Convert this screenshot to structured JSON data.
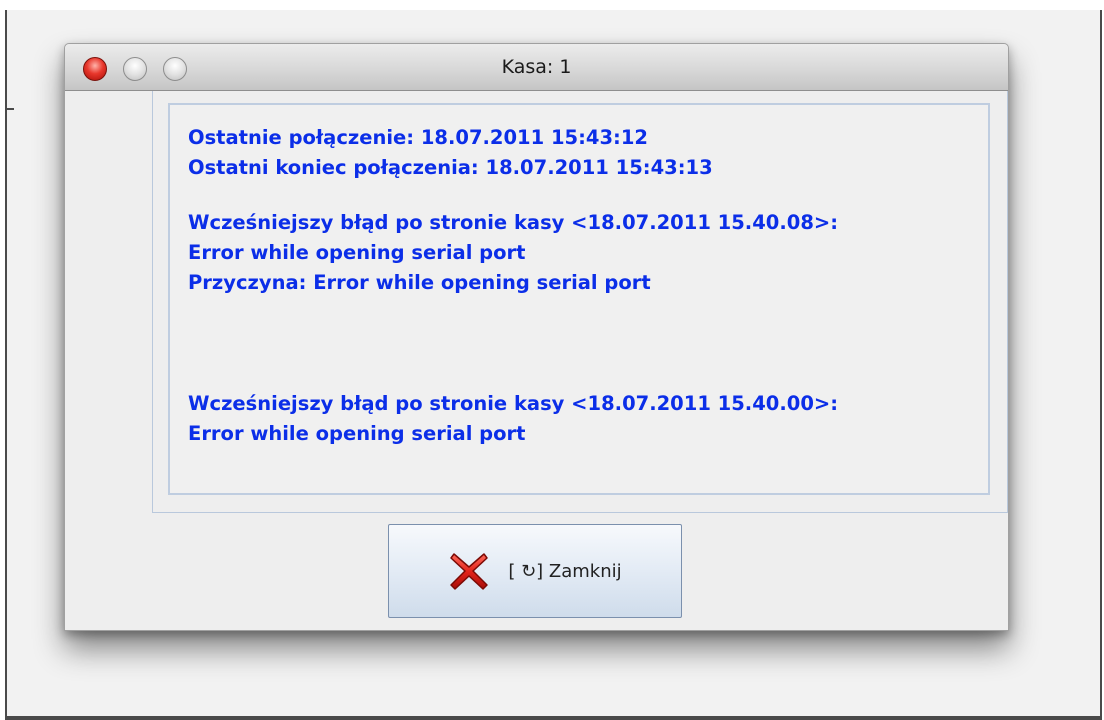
{
  "window": {
    "title": "Kasa: 1"
  },
  "info": {
    "lines_block1": [
      "Ostatnie połączenie: 18.07.2011 15:43:12",
      "Ostatni koniec połączenia: 18.07.2011 15:43:13"
    ],
    "lines_block2": [
      "Wcześniejszy błąd po stronie kasy <18.07.2011 15.40.08>:",
      "Error while opening serial port",
      "Przyczyna: Error while opening serial port"
    ],
    "lines_block3": [
      "Wcześniejszy błąd po stronie kasy <18.07.2011 15.40.00>:",
      "Error while opening serial port"
    ]
  },
  "close_button": {
    "label": "[ ↻] Zamknij",
    "icon": "red-x-icon"
  },
  "colors": {
    "info_text": "#0b2ee8",
    "close_light": "#e8372c",
    "button_border": "#7b90ad"
  }
}
